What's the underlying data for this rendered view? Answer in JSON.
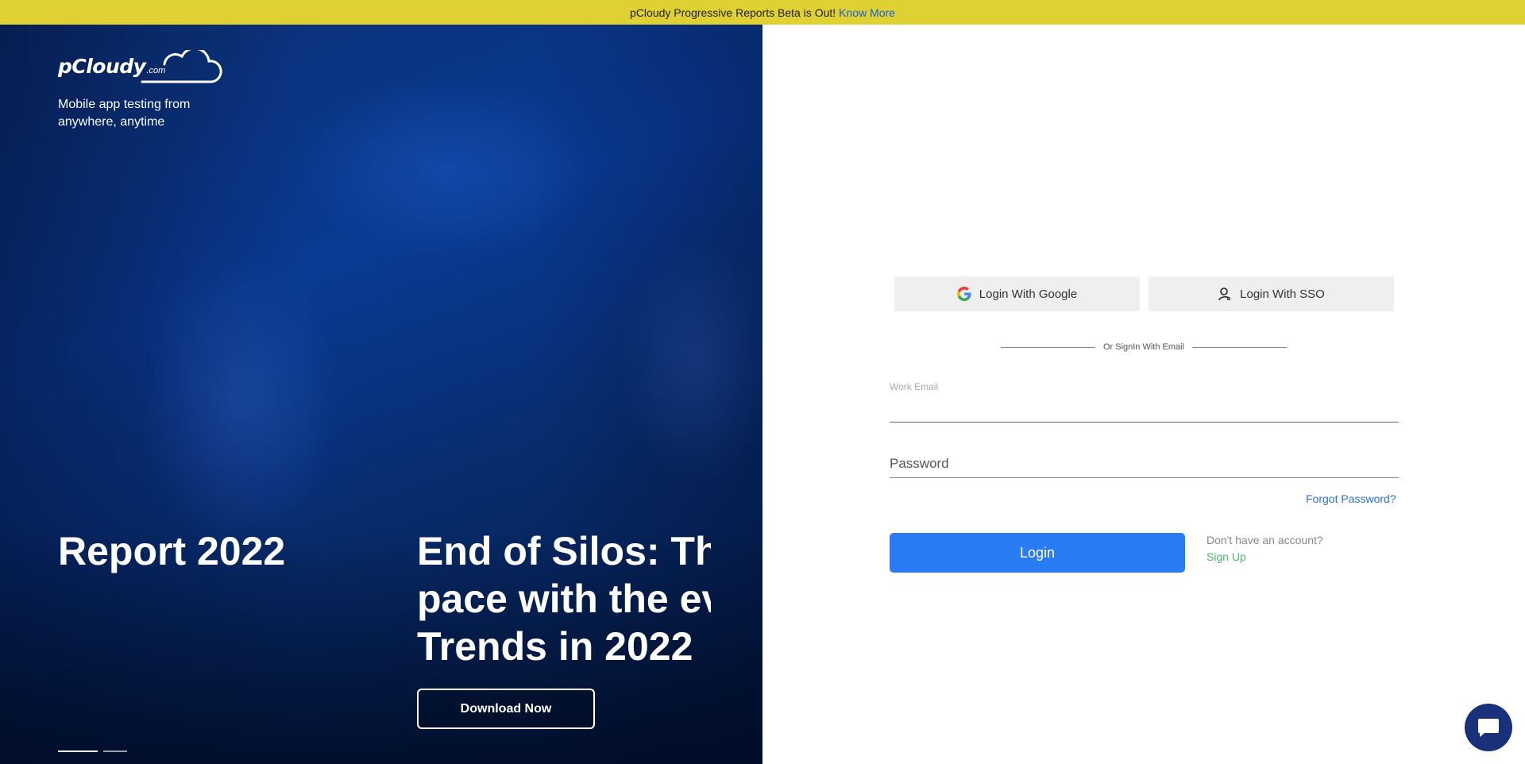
{
  "banner": {
    "text": "pCloudy Progressive Reports Beta is Out!",
    "link_text": "Know More"
  },
  "hero": {
    "logo_text": "pCloudy",
    "logo_suffix": ".com",
    "tagline": "Mobile app testing from anywhere, anytime",
    "slide_a_title": "Report 2022",
    "slide_b_title_line1": "End of Silos: The",
    "slide_b_title_line2": "pace with the eve",
    "slide_b_title_line3": "Trends in 2022",
    "download_label": "Download Now",
    "carousel": {
      "current": 1,
      "total": 2
    }
  },
  "login": {
    "google_label": "Login With Google",
    "sso_label": "Login With SSO",
    "divider_text": "Or SignIn With Email",
    "email_label": "Work Email",
    "email_value": "",
    "password_placeholder": "Password",
    "forgot_label": "Forgot Password?",
    "login_label": "Login",
    "no_account_text": "Don't have an account?",
    "signup_label": "Sign Up"
  },
  "colors": {
    "banner_bg": "#dfd034",
    "accent_blue": "#2a7cf4",
    "signup_green": "#49b86a",
    "chat_bg": "#18317a"
  },
  "icons": {
    "google": "google-icon",
    "sso": "user-key-icon",
    "chat": "chat-bubble-icon",
    "cloud": "cloud-icon"
  }
}
